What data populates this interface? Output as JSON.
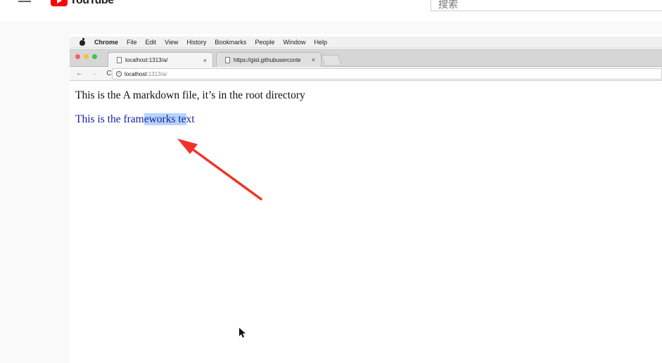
{
  "youtube": {
    "logo_text": "YouTube",
    "search_placeholder": "搜索"
  },
  "mac_menu": {
    "items": [
      "Chrome",
      "File",
      "Edit",
      "View",
      "History",
      "Bookmarks",
      "People",
      "Window",
      "Help"
    ]
  },
  "chrome": {
    "tabs": [
      {
        "label": "localhost:1313/a/",
        "close": "×"
      },
      {
        "label": "https://gist.githubuserconte",
        "close": "×"
      }
    ],
    "toolbar": {
      "back": "←",
      "forward": "→",
      "reload": "C",
      "info": "i",
      "url_host": "localhost",
      "url_path": ":1313/a/"
    }
  },
  "page": {
    "line1": "This is the A markdown file, it’s in the root directory",
    "line2_before": "This is the fram",
    "line2_selected": "eworks te",
    "line2_after": "xt"
  },
  "colors": {
    "youtube_red": "#ff0000",
    "link_blue": "#1a1aa6",
    "selection": "#b3d4fc",
    "annotation_arrow": "#f0342a"
  }
}
